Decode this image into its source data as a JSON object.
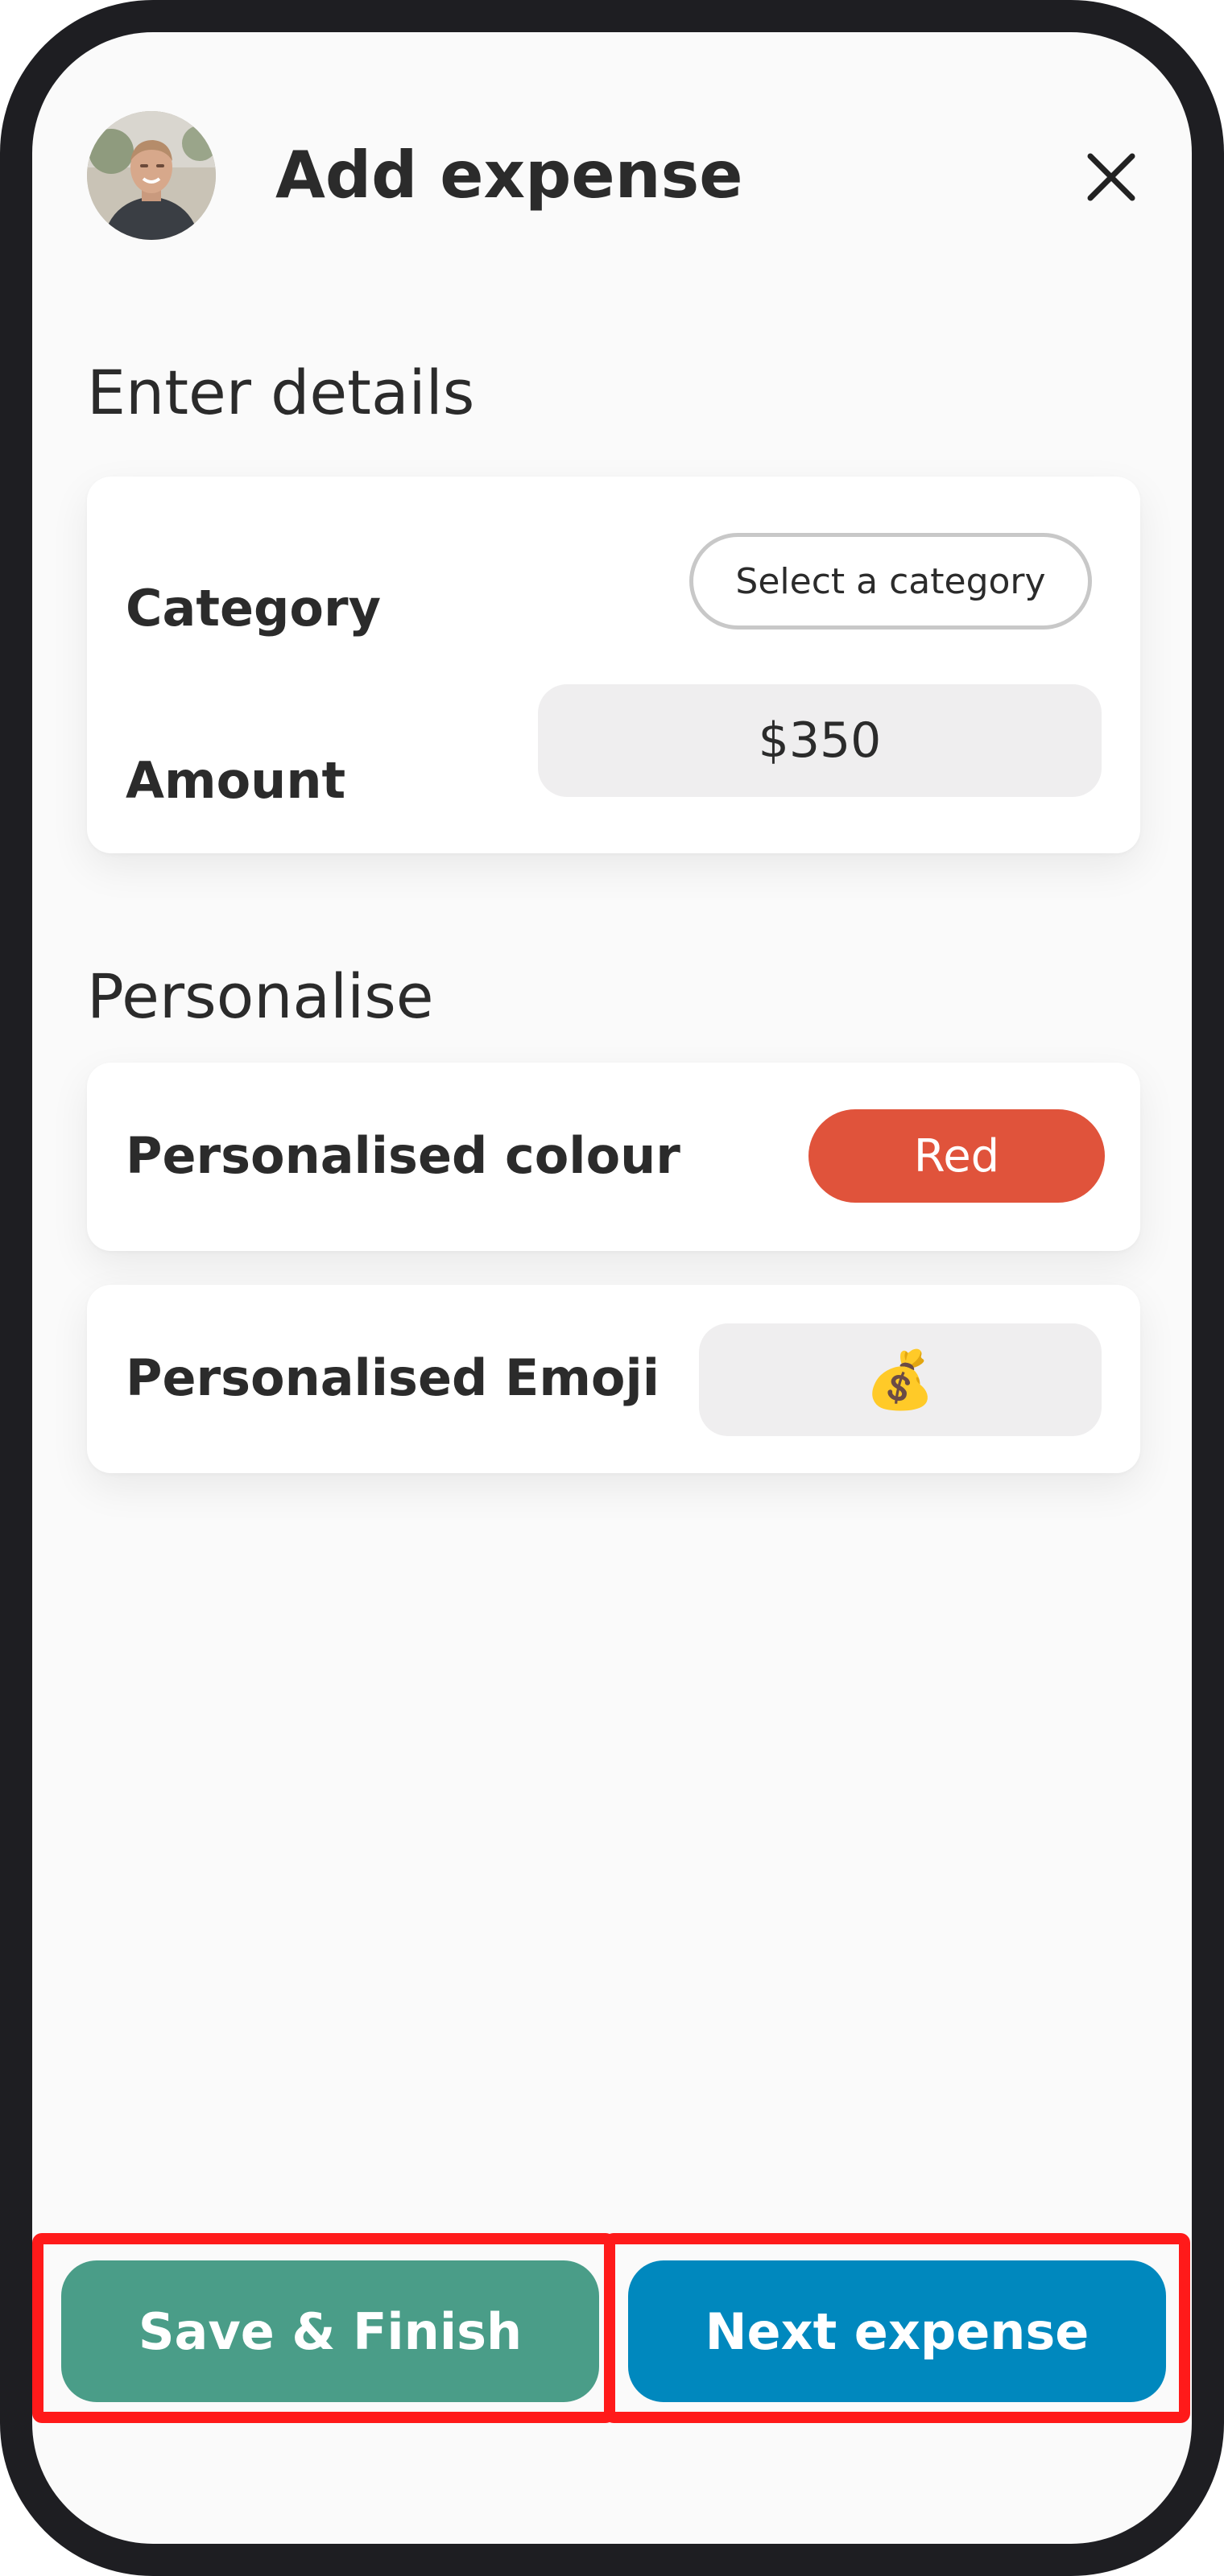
{
  "header": {
    "title": "Add expense",
    "avatar_icon": "user-avatar-photo",
    "close_icon": "close-icon"
  },
  "details": {
    "heading": "Enter details",
    "category_label": "Category",
    "category_value": "Select a category",
    "amount_label": "Amount",
    "amount_value": "$350"
  },
  "personalise": {
    "heading": "Personalise",
    "colour_label": "Personalised colour",
    "colour_value": "Red",
    "colour_hex": "#e0533b",
    "emoji_label": "Personalised Emoji",
    "emoji_value": "💰"
  },
  "footer": {
    "save_label": "Save & Finish",
    "save_color": "#4a9d88",
    "next_label": "Next expense",
    "next_color": "#0088be",
    "highlight_color": "#ff1a1a"
  }
}
